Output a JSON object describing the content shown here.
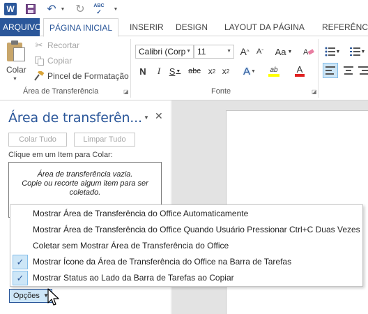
{
  "app": {
    "logo_letter": "W",
    "accent_color": "#2b579a",
    "spell_check_label": "ABC"
  },
  "qat": {
    "icons": [
      "word-logo",
      "save-icon",
      "undo-icon",
      "redo-icon",
      "spelling-grammar-icon",
      "customize-qat-icon"
    ]
  },
  "tabs": [
    {
      "label": "ARQUIVO"
    },
    {
      "label": "PÁGINA INICIAL"
    },
    {
      "label": "INSERIR"
    },
    {
      "label": "DESIGN"
    },
    {
      "label": "LAYOUT DA PÁGINA"
    },
    {
      "label": "REFERÊNCIA"
    }
  ],
  "ribbon": {
    "clipboard": {
      "paste_label": "Colar",
      "cut_label": "Recortar",
      "copy_label": "Copiar",
      "format_painter_label": "Pincel de Formatação",
      "group_label": "Área de Transferência"
    },
    "font": {
      "font_name": "Calibri (Corp",
      "font_size": "11",
      "grow_label": "A",
      "shrink_label": "A",
      "case_label": "Aa",
      "bold_label": "N",
      "italic_label": "I",
      "underline_label": "S",
      "strike_label": "abc",
      "subscript_label": "x",
      "superscript_label": "x",
      "subscript_index": "2",
      "superscript_index": "2",
      "effects_label": "A",
      "highlight_label": "ab",
      "font_color_label": "A",
      "group_label": "Fonte"
    }
  },
  "pane": {
    "title": "Área de transferên...",
    "paste_all": "Colar Tudo",
    "clear_all": "Limpar Tudo",
    "instruction": "Clique em um Item para Colar:",
    "empty_line1": "Área de transferência vazia.",
    "empty_line2": "Copie ou recorte algum item para ser",
    "empty_line3": "coletado.",
    "options_label": "Opções"
  },
  "options_menu": [
    {
      "label": "Mostrar Área de Transferência do Office Automaticamente",
      "checked": false
    },
    {
      "label": "Mostrar Área de Transferência do Office Quando Usuário Pressionar Ctrl+C Duas Vezes",
      "checked": false
    },
    {
      "label": "Coletar sem Mostrar Área de Transferência do Office",
      "checked": false
    },
    {
      "label": "Mostrar Ícone da Área de Transferência do Office na Barra de Tarefas",
      "checked": true
    },
    {
      "label": "Mostrar Status ao Lado da Barra de Tarefas ao Copiar",
      "checked": true
    }
  ]
}
